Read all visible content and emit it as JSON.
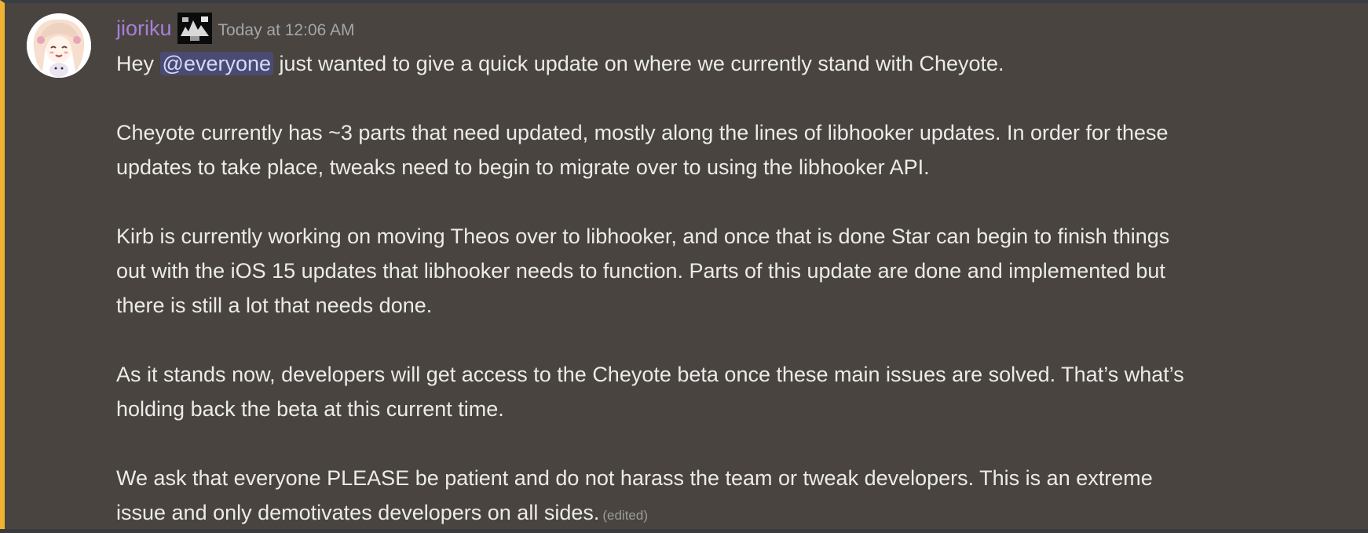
{
  "message": {
    "author": "jioriku",
    "timestamp": "Today at 12:06 AM",
    "mention": "@everyone",
    "edited_label": "(edited)",
    "paragraphs": {
      "p1_before": "Hey ",
      "p1_after": " just wanted to give a quick update on where we currently stand with Cheyote.",
      "p2_line1": "Cheyote currently has ~3 parts that need updated, mostly along the lines of libhooker updates. In order for these",
      "p2_line2": "updates to take place, tweaks need to begin to migrate over to using the libhooker API.",
      "p3_line1": "Kirb is currently working on moving Theos over to libhooker, and once that is done Star can begin to finish things",
      "p3_line2": "out with the iOS 15 updates that libhooker needs to function. Parts of this update are done and implemented but",
      "p3_line3": "there is still a lot that needs done.",
      "p4_line1": "As it stands now, developers will get access to the Cheyote beta once these main issues are solved. That’s what’s",
      "p4_line2": "holding back the beta at this current time.",
      "p5_line1": "We ask that everyone PLEASE be patient and do not harass the team or tweak developers. This is an extreme",
      "p5_line2": "issue and only demotivates developers on all sides."
    }
  },
  "colors": {
    "accent_border": "#f0b232",
    "username": "#a77fd9",
    "mention_bg": "#4a4b73",
    "background": "#49443f"
  },
  "icons": {
    "avatar": "anime-avatar-icon",
    "role": "role-badge-icon"
  }
}
